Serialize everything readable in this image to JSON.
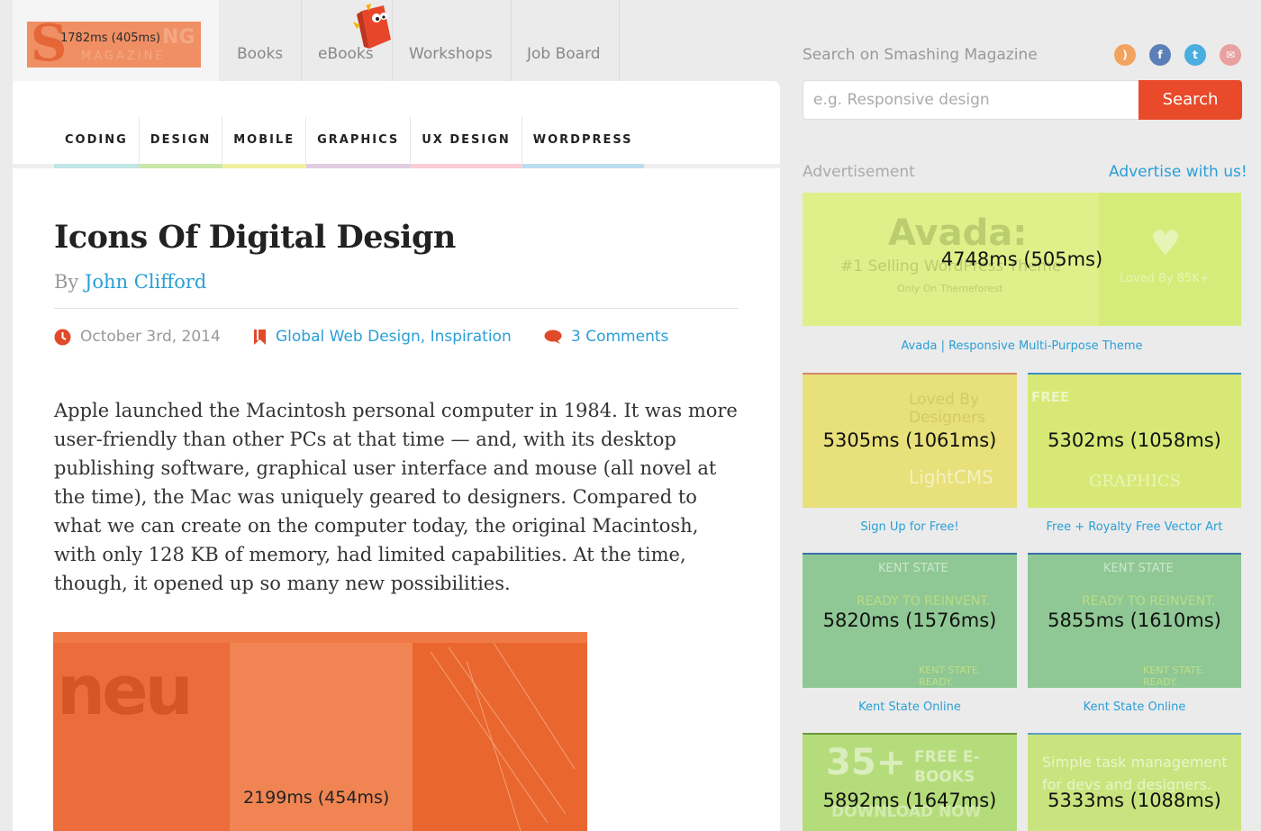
{
  "header": {
    "logo_timing": "1782ms (405ms)",
    "logo_tagline": "MAGAZINE",
    "logo_ghost_word": "NG",
    "nav": [
      "Books",
      "eBooks",
      "Workshops",
      "Job Board"
    ]
  },
  "categories": [
    {
      "label": "CODING",
      "color": "#bfe6e4"
    },
    {
      "label": "DESIGN",
      "color": "#c9e8a8"
    },
    {
      "label": "MOBILE",
      "color": "#f3f0a0"
    },
    {
      "label": "GRAPHICS",
      "color": "#e1cde3"
    },
    {
      "label": "UX DESIGN",
      "color": "#f8cdd3"
    },
    {
      "label": "WORDPRESS",
      "color": "#bcdcf0"
    }
  ],
  "article": {
    "title": "Icons Of Digital Design",
    "by": "By",
    "author": "John Clifford",
    "date": "October 3rd, 2014",
    "tags": "Global Web Design, Inspiration",
    "comments": "3 Comments",
    "body": "Apple launched the Macintosh personal computer in 1984. It was more user-friendly than other PCs at that time — and, with its desktop publishing software, graphical user interface and mouse (all novel at the time), the Mac was uniquely geared to designers. Compared to what we can create on the computer today, the original Macintosh, with only 128 KB of memory, had limited capabilities. At the time, though, it opened up so many new possibilities.",
    "hero_timing": "2199ms (454ms)",
    "hero_text": "neu"
  },
  "sidebar": {
    "search_label": "Search on Smashing Magazine",
    "search_placeholder": "e.g. Responsive design",
    "search_button": "Search",
    "ad_label": "Advertisement",
    "advertise_link": "Advertise with us!",
    "social": [
      "rss-icon",
      "facebook-icon",
      "twitter-icon",
      "email-icon"
    ],
    "ads": [
      {
        "timing": "4748ms (505ms)",
        "caption": "Avada | Responsive Multi-Purpose Theme",
        "ghost": "Avada:",
        "ghost2": "#1 Selling WordPress Theme",
        "ghost3": "Only On Themeforest",
        "ghost4": "Loved By 85K+"
      },
      {
        "timing": "5305ms (1061ms)",
        "caption": "Sign Up for Free!",
        "ghost": "LightCMS",
        "ghost2": "Loved By Designers"
      },
      {
        "timing": "5302ms (1058ms)",
        "caption": "Free + Royalty Free Vector Art",
        "ghost": "GRAPHICS",
        "ghost2": "FREE"
      },
      {
        "timing": "5820ms (1576ms)",
        "caption": "Kent State Online",
        "ghost": "KENT STATE",
        "ghost2": "READY TO REINVENT.",
        "ghost3": "KENT STATE. READY."
      },
      {
        "timing": "5855ms (1610ms)",
        "caption": "Kent State Online",
        "ghost": "KENT STATE",
        "ghost2": "READY TO REINVENT.",
        "ghost3": "KENT STATE. READY."
      },
      {
        "timing": "5892ms (1647ms)",
        "caption": "",
        "ghost": "35+",
        "ghost2": "FREE E-BOOKS",
        "ghost3": "DOWNLOAD NOW"
      },
      {
        "timing": "5333ms (1088ms)",
        "caption": "",
        "ghost": "Simple task management for devs and designers."
      }
    ]
  },
  "colors": {
    "accent_red": "#e84a2a",
    "link_blue": "#2a9fd6",
    "overlay_orange": "#f07a45",
    "overlay_lime": "#dff08a",
    "overlay_yellow": "#e8e07a",
    "overlay_green": "#8fc894"
  }
}
